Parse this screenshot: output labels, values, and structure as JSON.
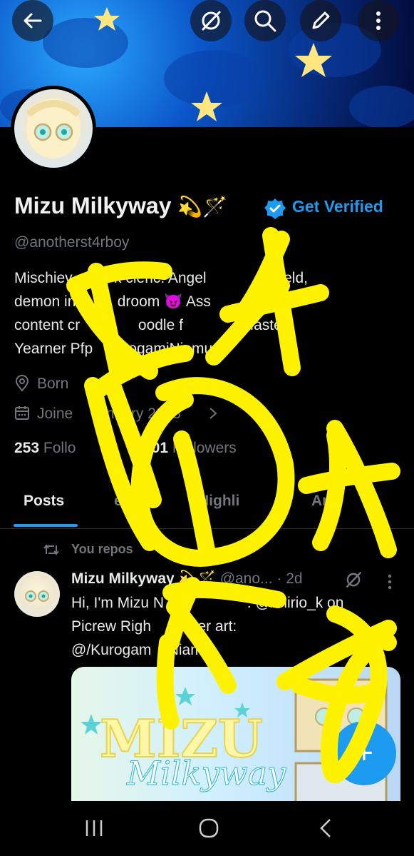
{
  "header": {
    "back_icon": "arrow-left-icon",
    "grok_icon": "grok-icon",
    "search_icon": "search-icon",
    "edit_icon": "pencil-icon",
    "more_icon": "more-vertical-icon"
  },
  "profile": {
    "name": "Mizu Milkyway",
    "name_emojis": "💫🪄",
    "get_verified": "Get Verified",
    "handle": "@anotherst4rboy",
    "bio_lines": [
      "Mischiev",
      "k cleric. Angel",
      "lefield,",
      "demon in",
      "droom",
      "Ass",
      "SFW",
      "content cr",
      "oodle f",
      "Master",
      "Yearner Pfp",
      "KurogamiNiamu"
    ],
    "bio_line1": "Mischiev          k cleric. Angel              lefield,",
    "bio_line2": "demon in          droom 😈 Ass              SFW",
    "bio_line3": "content cr              oodle f              Master",
    "bio_line4": "Yearner Pfp   KurogamiNiamu",
    "location": "Born",
    "joined": "Joine      anuary 2023",
    "following_count": "253",
    "following_label": "Follo",
    "followers_count": "101",
    "followers_label": "Followers"
  },
  "tabs": [
    {
      "label": "Posts",
      "active": true
    },
    {
      "label": "eplies",
      "active": false
    },
    {
      "label": "Highli",
      "active": false
    },
    {
      "label": "Ar",
      "active": false
    }
  ],
  "post": {
    "repost_label": "You repos",
    "author": "Mizu Milkyway",
    "author_emojis": "💫🪄",
    "handle": "@ano...",
    "time": "· 2d",
    "text_line1": "Hi, I'm Mizu N                    : @/mirio_k on",
    "text_line2": "Picrew Righ      orner art:",
    "text_line3": "@/Kurogam    Niamu",
    "media_title_1": "MIZU",
    "media_title_2": "Milkyway"
  },
  "fab_label": "+",
  "navbar": {
    "recents_icon": "recents-icon",
    "home_icon": "home-icon",
    "back_icon": "back-chevron-icon"
  },
  "colors": {
    "accent": "#1d9bf0",
    "background": "#000000",
    "scribble": "#fff200",
    "secondary_text": "#71767b"
  }
}
